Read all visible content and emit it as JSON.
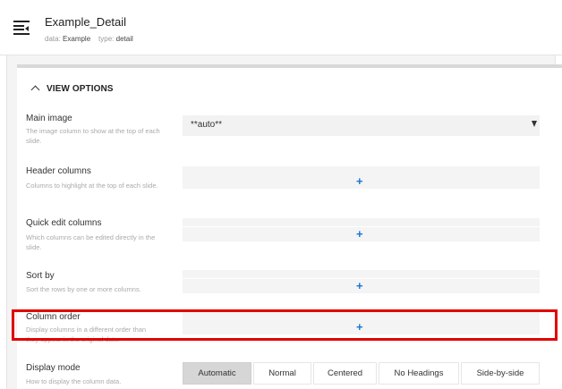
{
  "header": {
    "title": "Example_Detail",
    "data_label": "data:",
    "data_value": "Example",
    "type_label": "type:",
    "type_value": "detail"
  },
  "section": {
    "title": "VIEW OPTIONS"
  },
  "fields": {
    "main_image": {
      "label": "Main image",
      "help": "The image column to show at the top of each slide.",
      "value": "**auto**"
    },
    "header_columns": {
      "label": "Header columns",
      "help": "Columns to highlight at the top of each slide.",
      "add": "+"
    },
    "quick_edit": {
      "label": "Quick edit columns",
      "help": "Which columns can be edited directly in the slide.",
      "add": "+"
    },
    "sort_by": {
      "label": "Sort by",
      "help": "Sort the rows by one or more columns.",
      "add": "+"
    },
    "column_order": {
      "label": "Column order",
      "help": "Display columns in a different order than",
      "help_cont": "they appear in the original data.",
      "add": "+"
    },
    "display_mode": {
      "label": "Display mode",
      "help": "How to display the column data.",
      "options": [
        "Automatic",
        "Normal",
        "Centered",
        "No Headings",
        "Side-by-side"
      ],
      "selected": "Automatic"
    }
  },
  "colors": {
    "accent": "#1976d2",
    "highlight": "#e20000"
  },
  "icons": {
    "header": "view-list-icon",
    "collapse": "chevron-up-icon",
    "dropdown": "caret-down-icon",
    "add": "plus-icon"
  }
}
